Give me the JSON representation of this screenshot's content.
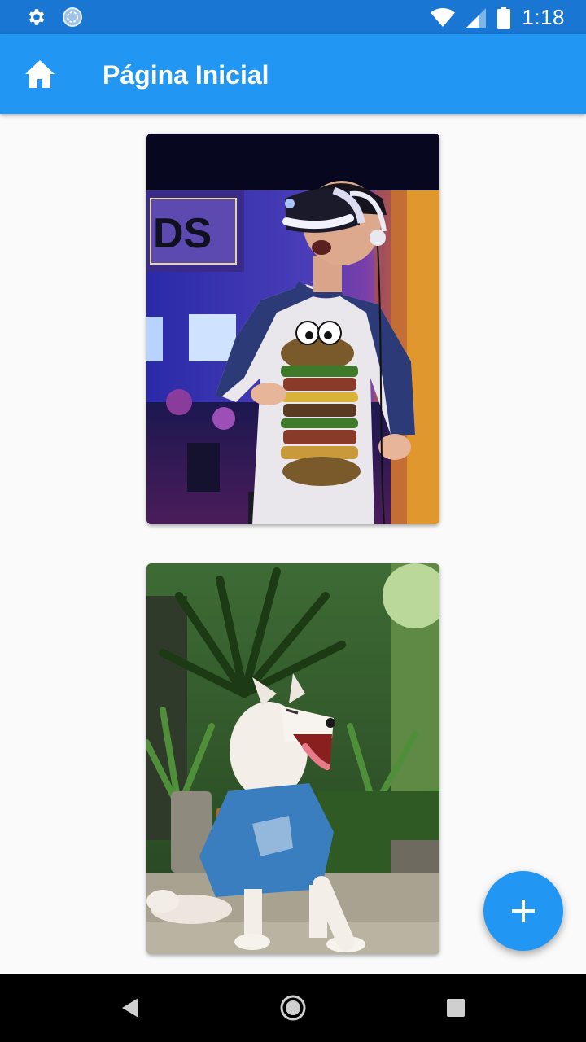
{
  "status_bar": {
    "time": "1:18",
    "icons": [
      "settings-icon",
      "sync-icon",
      "wifi-icon",
      "signal-icon",
      "battery-icon"
    ]
  },
  "app_bar": {
    "icon": "home-icon",
    "title": "Página Inicial"
  },
  "cards": [
    {
      "icon": "photo-vr-boy"
    },
    {
      "icon": "photo-dog-yawning"
    }
  ],
  "fab": {
    "icon": "plus-icon"
  },
  "nav_bar": {
    "icons": [
      "back-icon",
      "home-circle-icon",
      "recents-icon"
    ]
  },
  "colors": {
    "status_bar": "#1976d2",
    "app_bar": "#2196f3",
    "fab": "#2196f3",
    "background": "#fafafa"
  }
}
